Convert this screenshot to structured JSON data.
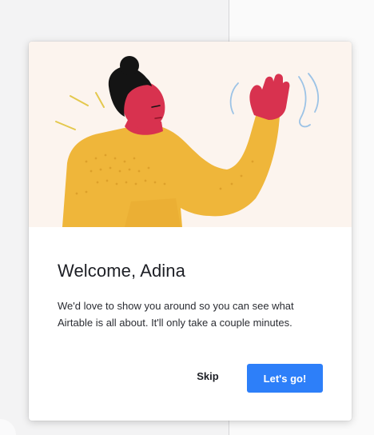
{
  "modal": {
    "title": "Welcome, Adina",
    "description": "We'd love to show you around so you can see what Airtable is all about. It'll only take a couple minutes.",
    "skip_label": "Skip",
    "primary_label": "Let's go!"
  },
  "illustration": {
    "subject": "person-waving",
    "colors": {
      "background": "#fcf4ee",
      "sweater": "#efb63a",
      "skin": "#d8324f",
      "hair": "#141414",
      "accent_lines": "#e4c84d",
      "wave_lines": "#9cc3e6"
    }
  },
  "colors": {
    "primary_button": "#2d7ff9",
    "title_text": "#1d1f25"
  }
}
